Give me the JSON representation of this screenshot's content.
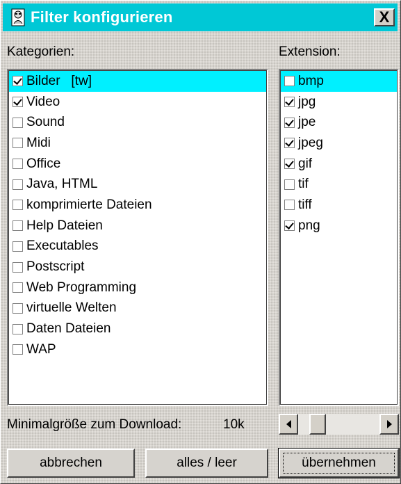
{
  "window": {
    "title": "Filter konfigurieren",
    "close_label": "X"
  },
  "labels": {
    "categories": "Kategorien:",
    "extensions": "Extension:",
    "min_size": "Minimalgröße zum Download:",
    "min_size_value": "10k"
  },
  "categories": [
    {
      "label": "Bilder   [tw]",
      "checked": true,
      "selected": true
    },
    {
      "label": "Video",
      "checked": true,
      "selected": false
    },
    {
      "label": "Sound",
      "checked": false,
      "selected": false
    },
    {
      "label": "Midi",
      "checked": false,
      "selected": false
    },
    {
      "label": "Office",
      "checked": false,
      "selected": false
    },
    {
      "label": "Java, HTML",
      "checked": false,
      "selected": false
    },
    {
      "label": "komprimierte Dateien",
      "checked": false,
      "selected": false
    },
    {
      "label": "Help Dateien",
      "checked": false,
      "selected": false
    },
    {
      "label": "Executables",
      "checked": false,
      "selected": false
    },
    {
      "label": "Postscript",
      "checked": false,
      "selected": false
    },
    {
      "label": "Web Programming",
      "checked": false,
      "selected": false
    },
    {
      "label": "virtuelle Welten",
      "checked": false,
      "selected": false
    },
    {
      "label": "Daten Dateien",
      "checked": false,
      "selected": false
    },
    {
      "label": "WAP",
      "checked": false,
      "selected": false
    }
  ],
  "extensions": [
    {
      "label": "bmp",
      "checked": false,
      "selected": true
    },
    {
      "label": "jpg",
      "checked": true,
      "selected": false
    },
    {
      "label": "jpe",
      "checked": true,
      "selected": false
    },
    {
      "label": "jpeg",
      "checked": true,
      "selected": false
    },
    {
      "label": "gif",
      "checked": true,
      "selected": false
    },
    {
      "label": "tif",
      "checked": false,
      "selected": false
    },
    {
      "label": "tiff",
      "checked": false,
      "selected": false
    },
    {
      "label": "png",
      "checked": true,
      "selected": false
    }
  ],
  "slider": {
    "value_fraction": 0.2
  },
  "buttons": {
    "cancel": "abbrechen",
    "toggle_all": "alles / leer",
    "apply": "übernehmen"
  },
  "colors": {
    "titlebar": "#00c8d6",
    "selection": "#00f0ff"
  },
  "icons": {
    "app": "app-icon",
    "close": "close-icon",
    "scroll_left": "arrow-left-icon",
    "scroll_right": "arrow-right-icon"
  }
}
